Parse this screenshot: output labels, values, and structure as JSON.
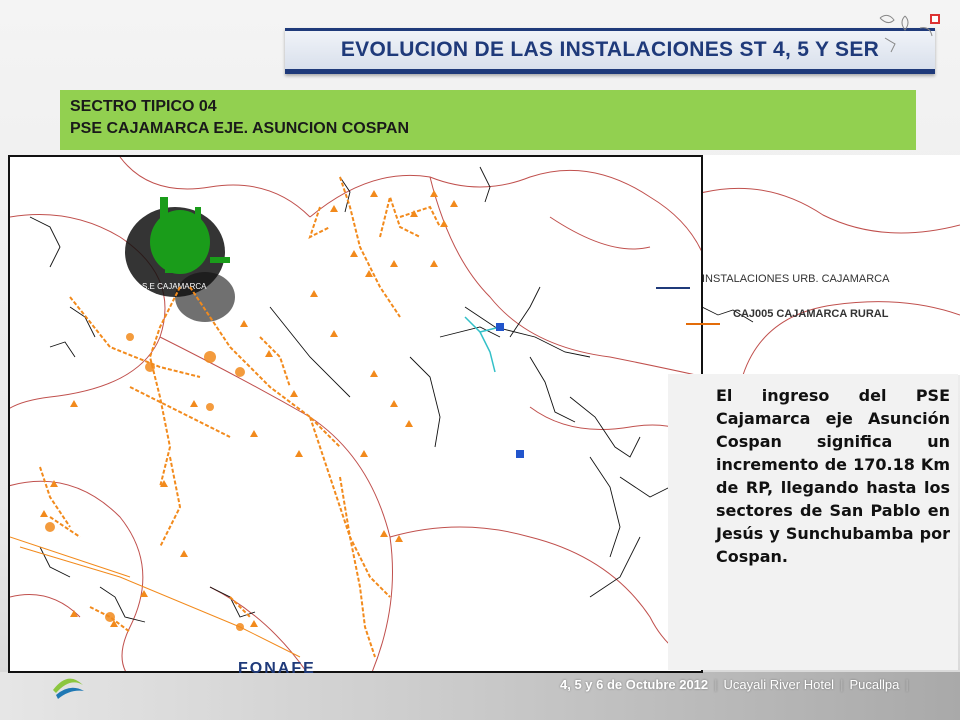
{
  "header": {
    "title": "EVOLUCION DE LAS INSTALACIONES ST 4, 5 Y SER"
  },
  "subheader": {
    "line1": "SECTRO TIPICO 04",
    "line2": "PSE CAJAMARCA EJE. ASUNCION COSPAN"
  },
  "map": {
    "city_label": "S.E CAJAMARCA",
    "colors": {
      "urban": "#1a9c1a",
      "rural": "#f28a1c",
      "boundary": "#c0504d",
      "network": "#111111",
      "other_network": "#33c0c8"
    }
  },
  "legend": {
    "items": [
      {
        "label": "INSTALACIONES  URB.  CAJAMARCA",
        "color": "#1f3a7a"
      },
      {
        "label": "CAJ005 CAJAMARCA RURAL",
        "color": "#e36c09"
      }
    ]
  },
  "description": {
    "text": "El ingreso del PSE Cajamarca eje Asunción Cospan significa un incremento de 170.18 Km de RP, llegando hasta los sectores de San Pablo en Jesús y Sunchubamba por Cospan."
  },
  "footer": {
    "logo_text": "FONAFE",
    "date": "4, 5 y 6 de Octubre 2012",
    "venue": "Ucayali River Hotel",
    "city": "Pucallpa"
  }
}
